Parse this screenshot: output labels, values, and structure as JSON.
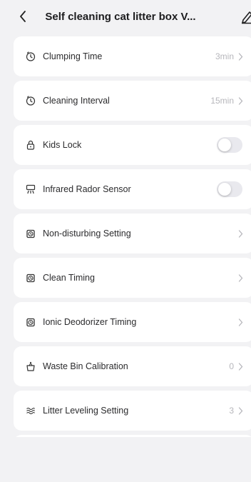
{
  "header": {
    "title": "Self cleaning cat litter box V...",
    "back_icon": "chevron-left-icon",
    "edit_icon": "pencil-icon"
  },
  "settings": [
    {
      "icon": "timer-icon",
      "label": "Clumping Time",
      "value": "3min",
      "control": "chevron"
    },
    {
      "icon": "timer-icon",
      "label": "Cleaning Interval",
      "value": "15min",
      "control": "chevron"
    },
    {
      "icon": "lock-icon",
      "label": "Kids Lock",
      "value": "",
      "control": "toggle",
      "on": false
    },
    {
      "icon": "sensor-icon",
      "label": "Infrared Rador Sensor",
      "value": "",
      "control": "toggle",
      "on": false
    },
    {
      "icon": "alarm-clock-icon",
      "label": "Non-disturbing Setting",
      "value": "",
      "control": "chevron"
    },
    {
      "icon": "alarm-clock-icon",
      "label": "Clean Timing",
      "value": "",
      "control": "chevron"
    },
    {
      "icon": "alarm-clock-icon",
      "label": "Ionic Deodorizer Timing",
      "value": "",
      "control": "chevron"
    },
    {
      "icon": "bin-icon",
      "label": "Waste Bin Calibration",
      "value": "0",
      "control": "chevron"
    },
    {
      "icon": "waves-icon",
      "label": "Litter Leveling Setting",
      "value": "3",
      "control": "chevron"
    }
  ],
  "colors": {
    "background": "#f2f2f4",
    "card": "#ffffff",
    "value_text": "#b6b6bb",
    "toggle_off": "#e9e9ee"
  }
}
